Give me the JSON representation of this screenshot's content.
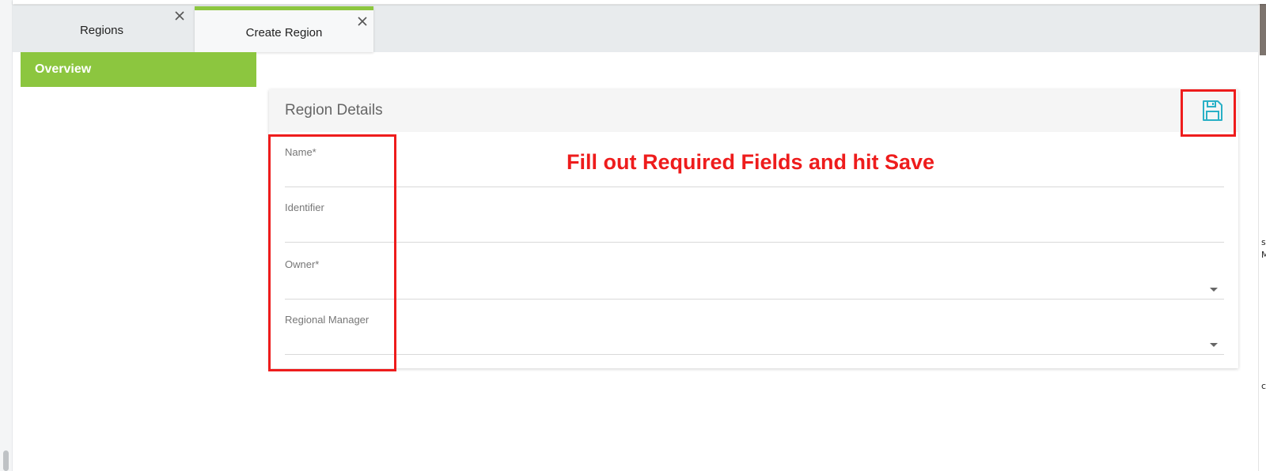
{
  "tabs": [
    {
      "label": "Regions"
    },
    {
      "label": "Create Region"
    }
  ],
  "sidebar": {
    "items": [
      {
        "label": "Overview"
      }
    ]
  },
  "card": {
    "title": "Region Details",
    "fields": [
      {
        "label": "Name*",
        "value": ""
      },
      {
        "label": "Identifier",
        "value": ""
      },
      {
        "label": "Owner*",
        "value": ""
      },
      {
        "label": "Regional Manager",
        "value": ""
      }
    ]
  },
  "annotation": {
    "text": "Fill out Required Fields and hit Save",
    "color": "#ee1c1c"
  },
  "colors": {
    "accent": "#8cc63f",
    "save_icon": "#29b0c6"
  },
  "icons": {
    "tab_close": "close-icon",
    "save": "floppy-disk-icon",
    "dropdown": "caret-down-icon"
  }
}
